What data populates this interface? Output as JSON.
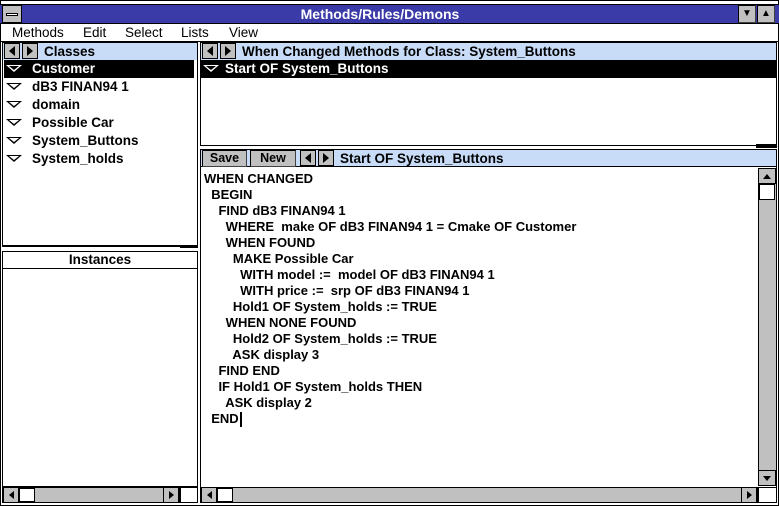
{
  "window": {
    "title": "Methods/Rules/Demons"
  },
  "menu": [
    "Methods",
    "Edit",
    "Select",
    "Lists",
    "View"
  ],
  "classes_panel": {
    "header": "Classes",
    "items": [
      {
        "label": "Customer",
        "selected": true
      },
      {
        "label": "dB3 FINAN94 1",
        "selected": false
      },
      {
        "label": "domain",
        "selected": false
      },
      {
        "label": "Possible Car",
        "selected": false
      },
      {
        "label": "System_Buttons",
        "selected": false
      },
      {
        "label": "System_holds",
        "selected": false
      }
    ]
  },
  "instances_panel": {
    "header": "Instances"
  },
  "methods_panel": {
    "header": "When Changed Methods for Class: System_Buttons",
    "items": [
      {
        "label": "Start OF System_Buttons",
        "selected": true
      }
    ]
  },
  "editor": {
    "save_label": "Save",
    "new_label": "New",
    "current": "Start OF System_Buttons",
    "lines": [
      "WHEN CHANGED",
      "  BEGIN",
      "    FIND dB3 FINAN94 1",
      "      WHERE  make OF dB3 FINAN94 1 = Cmake OF Customer",
      "      WHEN FOUND",
      "        MAKE Possible Car",
      "          WITH model :=  model OF dB3 FINAN94 1",
      "          WITH price :=  srp OF dB3 FINAN94 1",
      "        Hold1 OF System_holds := TRUE",
      "      WHEN NONE FOUND",
      "        Hold2 OF System_holds := TRUE",
      "        ASK display 3",
      "    FIND END",
      "    IF Hold1 OF System_holds THEN",
      "      ASK display 2",
      "  END"
    ]
  },
  "colors": {
    "titlebar": "#3a3aa8",
    "header_bg": "#c8dcf8",
    "chrome": "#c0c0c0",
    "selection": "#000000"
  }
}
